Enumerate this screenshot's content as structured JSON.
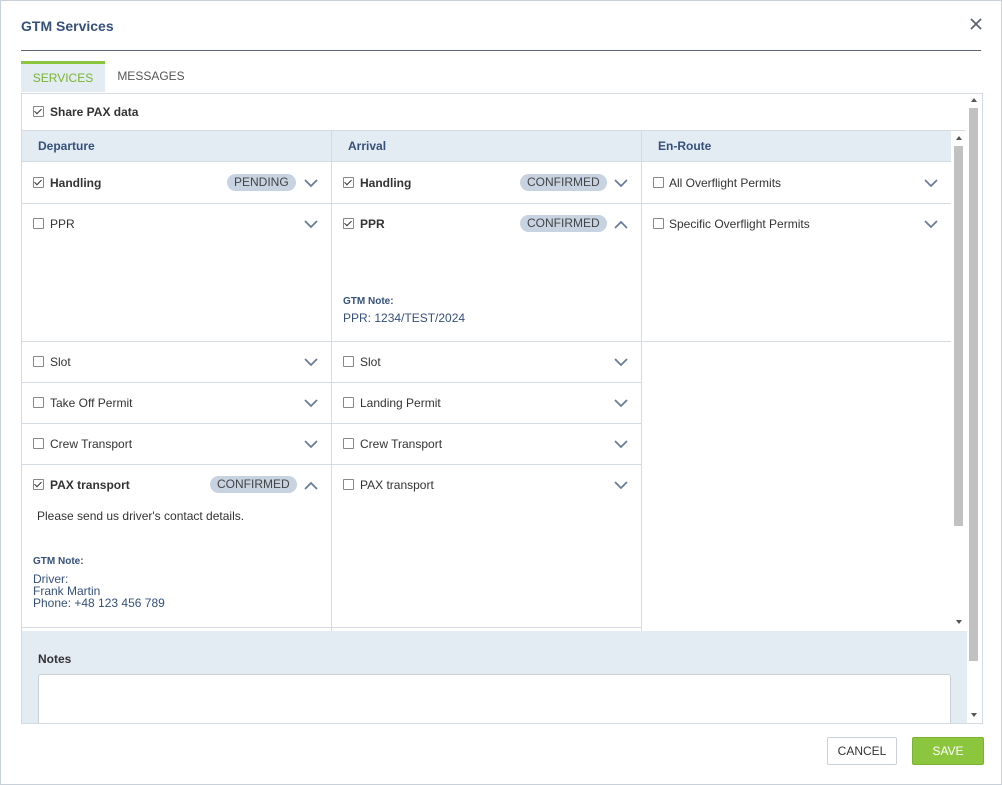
{
  "dialog": {
    "title": "GTM Services"
  },
  "tabs": [
    {
      "label": "SERVICES"
    },
    {
      "label": "MESSAGES"
    }
  ],
  "share": {
    "label": "Share PAX data",
    "checked": true
  },
  "columns": {
    "departure": "Departure",
    "arrival": "Arrival",
    "enroute": "En-Route"
  },
  "departure": {
    "handling": {
      "label": "Handling",
      "status": "PENDING"
    },
    "ppr": {
      "label": "PPR"
    },
    "slot": {
      "label": "Slot"
    },
    "takeoff": {
      "label": "Take Off Permit"
    },
    "crew": {
      "label": "Crew Transport"
    },
    "pax": {
      "label": "PAX transport",
      "status": "CONFIRMED",
      "message": "Please send us driver's contact details.",
      "note_label": "GTM Note:",
      "note_line1": "Driver:",
      "note_line2": "Frank Martin",
      "note_line3": "Phone: +48 123 456 789"
    }
  },
  "arrival": {
    "handling": {
      "label": "Handling",
      "status": "CONFIRMED"
    },
    "ppr": {
      "label": "PPR",
      "status": "CONFIRMED",
      "note_label": "GTM Note:",
      "note_value": "PPR: 1234/TEST/2024"
    },
    "slot": {
      "label": "Slot"
    },
    "landing": {
      "label": "Landing Permit"
    },
    "crew": {
      "label": "Crew Transport"
    },
    "pax": {
      "label": "PAX transport"
    }
  },
  "enroute": {
    "all_overflight": {
      "label": "All Overflight Permits"
    },
    "specific_overflight": {
      "label": "Specific Overflight Permits"
    }
  },
  "notes": {
    "label": "Notes",
    "value": ""
  },
  "footer": {
    "cancel": "CANCEL",
    "save": "SAVE"
  },
  "colors": {
    "accent": "#8cc63f",
    "header_bg": "#e3ebf3",
    "title": "#35507a",
    "badge": "#c7d3e1"
  }
}
